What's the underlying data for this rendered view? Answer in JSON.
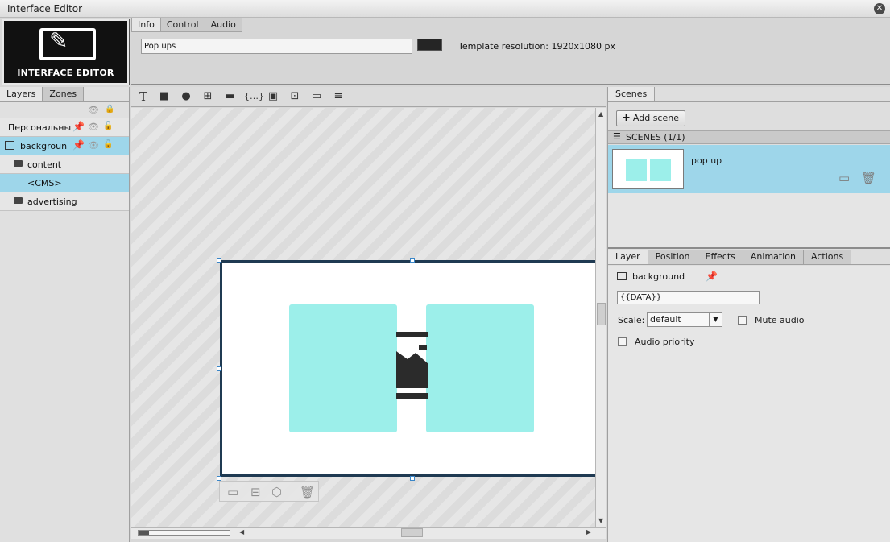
{
  "window": {
    "title": "Interface Editor"
  },
  "logo": {
    "text": "INTERFACE EDITOR"
  },
  "top_tabs": [
    "Info",
    "Control",
    "Audio"
  ],
  "info": {
    "template_name": "Pop ups",
    "color": "#252525",
    "resolution_text": "Template resolution: 1920x1080 px"
  },
  "left_tabs": [
    "Layers",
    "Zones"
  ],
  "layers": [
    {
      "label": "Персональные",
      "type": "zone",
      "selected": false
    },
    {
      "label": "backgrounc",
      "type": "image",
      "selected": true
    },
    {
      "label": "content",
      "type": "folder",
      "selected": false
    },
    {
      "label": "<CMS>",
      "type": "cms",
      "selected": true
    },
    {
      "label": "advertising",
      "type": "folder",
      "selected": false
    }
  ],
  "toolbar_icons": [
    "text-tool",
    "rectangle-tool",
    "ellipse-tool",
    "add-zone-tool",
    "rounded-rect-tool",
    "code-tool",
    "image-tool",
    "input-tool",
    "button-tool",
    "align-tool"
  ],
  "colors": {
    "selection": "#9ed6ea",
    "zone": "#9cefea",
    "stage_border": "#1f3a52"
  },
  "scenes_panel": {
    "tab": "Scenes",
    "add_button": "Add scene",
    "header": "SCENES (1/1)",
    "items": [
      {
        "name": "pop up"
      }
    ]
  },
  "props_tabs": [
    "Layer",
    "Position",
    "Effects",
    "Animation",
    "Actions"
  ],
  "layer_props": {
    "name": "background",
    "data_value": "{{DATA}}",
    "scale_label": "Scale:",
    "scale_value": "default",
    "mute_audio_label": "Mute audio",
    "mute_audio_checked": false,
    "audio_priority_label": "Audio priority",
    "audio_priority_checked": false
  }
}
